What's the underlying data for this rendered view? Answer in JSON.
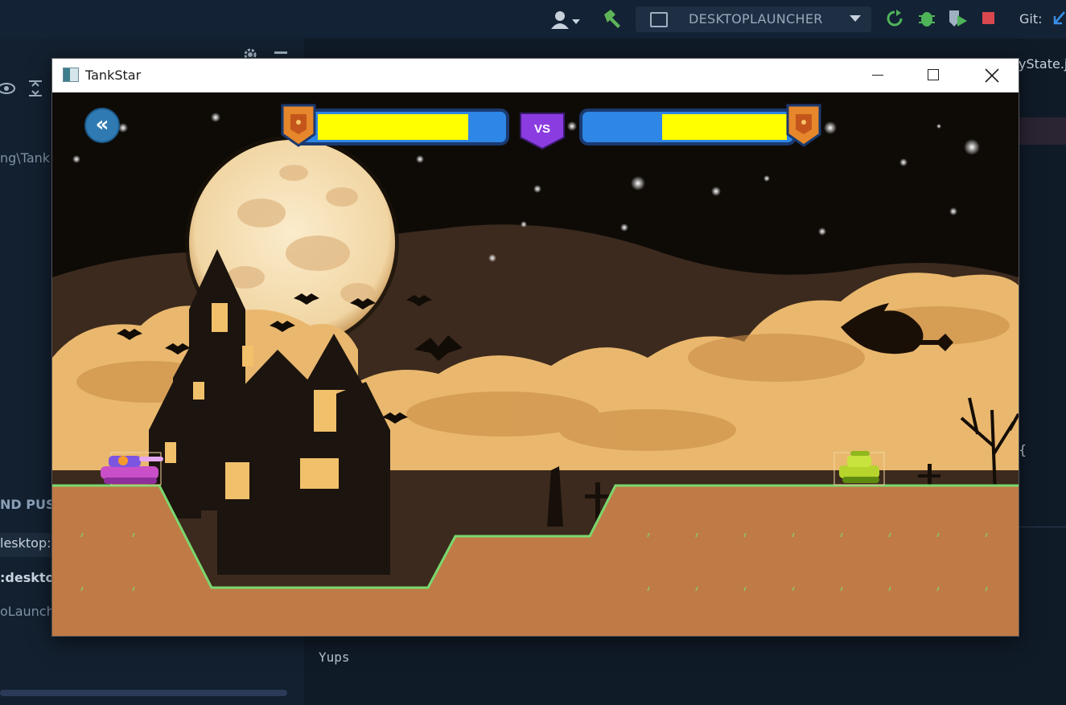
{
  "ide": {
    "run_config_label": "DESKTOPLAUNCHER",
    "git_label": "Git:",
    "left_texts": {
      "path": "ng\\Tank",
      "push": "ND PUSI",
      "desktop1": "lesktop:[",
      "desktop2": ":deskto",
      "launcher": "oLaunche"
    },
    "right_texts": {
      "tab_fragment": "yState.j",
      "brace": "{",
      "console_line": "Yups"
    }
  },
  "window": {
    "title": "TankStar",
    "controls": [
      "minimize",
      "maximize",
      "close"
    ]
  },
  "game": {
    "back_button_icon": "double-chevron-left-icon",
    "vs_label": "VS",
    "player1": {
      "health_fraction": 0.82,
      "tank_color": "pink-purple"
    },
    "player2": {
      "health_fraction": 0.68,
      "tank_color": "lime-green"
    },
    "colors": {
      "health_fill": "#ffff00",
      "health_bg": "#2e86e6",
      "ground": "#c07a46",
      "ground_edge": "#7ad86e",
      "sky": "#0e0b07"
    }
  }
}
